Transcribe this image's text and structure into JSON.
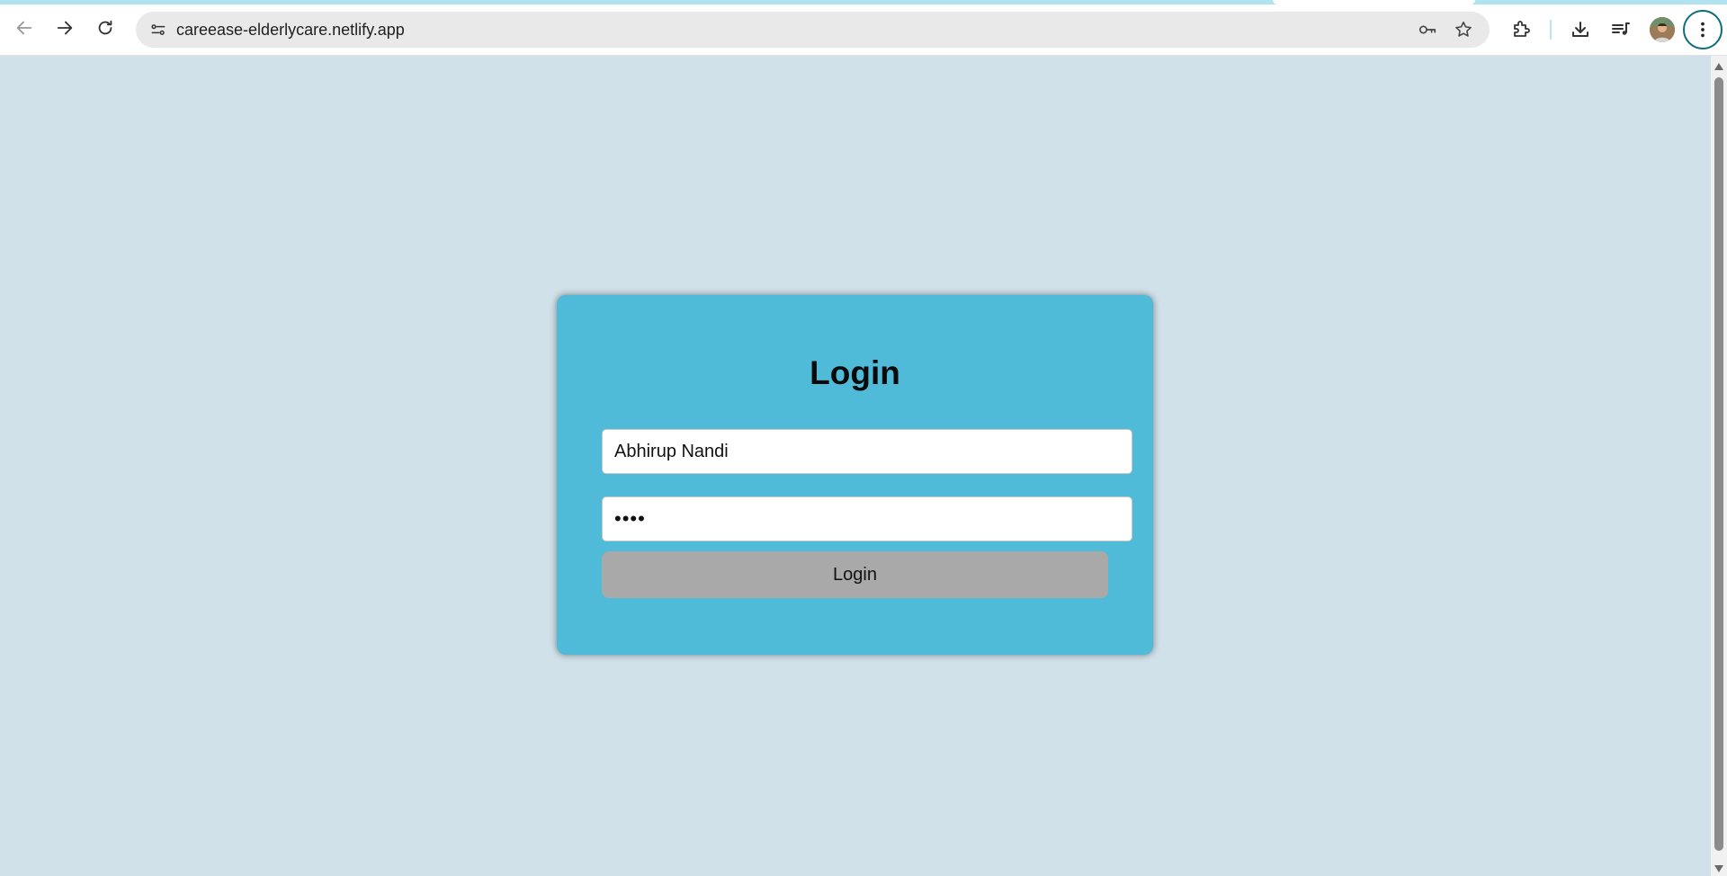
{
  "browser": {
    "url": "careease-elderlycare.netlify.app",
    "icons": {
      "back": "back-arrow-icon",
      "forward": "forward-arrow-icon",
      "reload": "reload-icon",
      "site_info": "site-settings-icon",
      "password": "key-icon",
      "bookmark": "star-icon",
      "extensions": "puzzle-icon",
      "downloads": "download-icon",
      "media": "media-playlist-icon",
      "profile": "avatar",
      "menu": "kebab-menu-icon"
    }
  },
  "login": {
    "title": "Login",
    "username_value": "Abhirup Nandi",
    "password_value": "••••",
    "button_label": "Login"
  },
  "colors": {
    "page_background": "#d0e1e9",
    "card_background": "#50bbd8",
    "button_background": "#a9a9a9",
    "accent": "#0b6e78"
  }
}
